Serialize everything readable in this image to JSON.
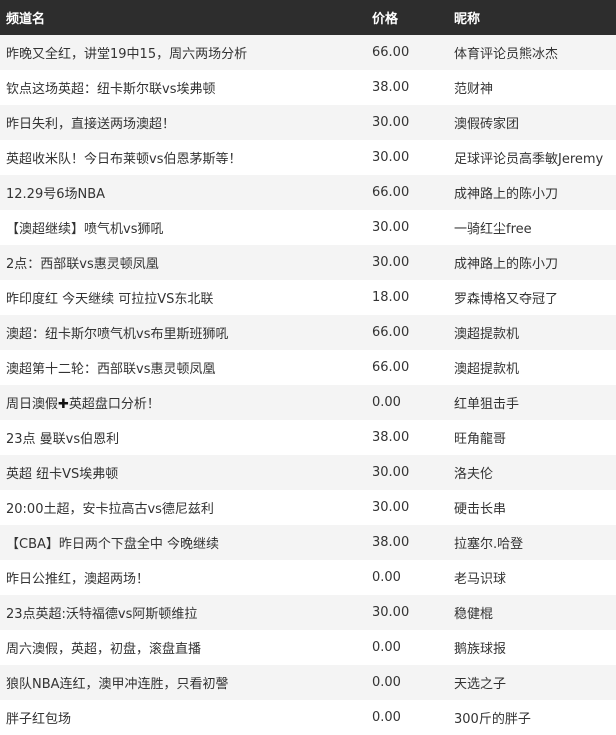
{
  "header": {
    "channel_name": "频道名",
    "price": "价格",
    "nickname": "昵称"
  },
  "rows": [
    {
      "title": "昨晚又全红，讲堂19中15，周六两场分析",
      "price": "66.00",
      "nickname": "体育评论员熊冰杰"
    },
    {
      "title": "钦点这场英超：纽卡斯尔联vs埃弗顿",
      "price": "38.00",
      "nickname": "范财神"
    },
    {
      "title": "昨日失利，直接送两场澳超！",
      "price": "30.00",
      "nickname": "澳假砖家团"
    },
    {
      "title": "英超收米队！今日布莱顿vs伯恩茅斯等！",
      "price": "30.00",
      "nickname": "足球评论员高季敏Jeremy"
    },
    {
      "title": "12.29号6场NBA",
      "price": "66.00",
      "nickname": "成神路上的陈小刀"
    },
    {
      "title": "【澳超继续】喷气机vs狮吼",
      "price": "30.00",
      "nickname": "一骑红尘free"
    },
    {
      "title": "2点：西部联vs惠灵顿凤凰",
      "price": "30.00",
      "nickname": "成神路上的陈小刀"
    },
    {
      "title": "昨印度红 今天继续 可拉拉VS东北联",
      "price": "18.00",
      "nickname": "罗森博格又夺冠了"
    },
    {
      "title": "澳超：纽卡斯尔喷气机vs布里斯班狮吼",
      "price": "66.00",
      "nickname": "澳超提款机"
    },
    {
      "title": "澳超第十二轮：西部联vs惠灵顿凤凰",
      "price": "66.00",
      "nickname": "澳超提款机"
    },
    {
      "title_before": "周日澳假",
      "title_symbol": "✚",
      "title_after": "英超盘口分析！",
      "price": "0.00",
      "nickname": "红单狙击手"
    },
    {
      "title": "23点 曼联vs伯恩利",
      "price": "38.00",
      "nickname": "旺角龍哥"
    },
    {
      "title": "英超 纽卡VS埃弗顿",
      "price": "30.00",
      "nickname": "洛夫伦"
    },
    {
      "title": "20:00土超，安卡拉高古vs德尼兹利",
      "price": "30.00",
      "nickname": "硬击长串"
    },
    {
      "title": "【CBA】昨日两个下盘全中 今晚继续",
      "price": "38.00",
      "nickname": "拉塞尔.哈登"
    },
    {
      "title": "昨日公推红，澳超两场！",
      "price": "0.00",
      "nickname": "老马识球"
    },
    {
      "title": "23点英超:沃特福德vs阿斯顿维拉",
      "price": "30.00",
      "nickname": "稳健棍"
    },
    {
      "title": "周六澳假，英超，初盘，滚盘直播",
      "price": "0.00",
      "nickname": "鹅族球报"
    },
    {
      "title": "狼队NBA连红，澳甲冲连胜，只看初謦",
      "price": "0.00",
      "nickname": "天选之子"
    },
    {
      "title": "胖子红包场",
      "price": "0.00",
      "nickname": "300斤的胖子"
    }
  ]
}
